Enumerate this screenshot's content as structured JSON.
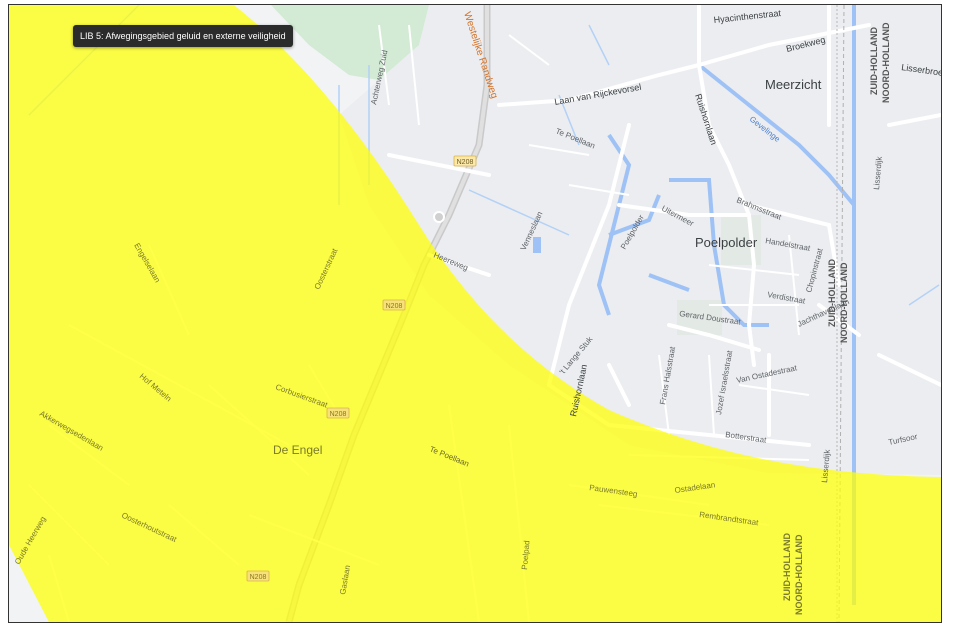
{
  "tooltip": {
    "text": "LIB 5: Afwegingsgebied geluid en externe veiligheid"
  },
  "overlay": {
    "color": "#ffff00",
    "opacity": 0.72
  },
  "places": {
    "meerzicht": "Meerzicht",
    "poelpolder": "Poelpolder",
    "de_engel": "De Engel"
  },
  "roads": {
    "westelijke_randweg": "Westelijke Randweg",
    "laan_van_rijckevorsel": "Laan van Rijckevorsel",
    "hyacinthenstraat": "Hyacinthenstraat",
    "broekweg": "Broekweg",
    "lisserbroek": "Lisserbroe",
    "ruishornlaan_north": "Ruishornlaan",
    "ruishornlaan_south": "Ruishornlaan",
    "gevelinge": "Gevelinge",
    "brahmsstraat": "Brahmsstraat",
    "handelstraat": "Handelstraat",
    "chopinstraat": "Chopinstraat",
    "verdistraat": "Verdistraat",
    "uitermeer": "Uitermeer",
    "poelpolder_road": "Poelpolder",
    "te_poellaan_top": "Te Poellaan",
    "te_poellaan_bottom": "Te Poellaan",
    "heereweg": "Heereweg",
    "venneslaan": "Venneslaan",
    "gerard_doustraat": "Gerard Doustraat",
    "jacob_cats": "'t Lange Stuk",
    "frans_halsstraat": "Frans Halsstraat",
    "jozef_israelsstraat": "Jozef Israelsstraat",
    "van_ostadestraat": "Van Ostadestraat",
    "botterstraat": "Botterstraat",
    "lisserdijk_top": "Lisserdijk",
    "lisserdijk_bottom": "Lisserdijk",
    "tortosoor": "Turfsoor",
    "achterweg_zuid": "Achterweg Zuid",
    "engelselaan": "Engelselaan",
    "oosterstraat": "Oosterstraat",
    "de_engel_street": "Corbusierstraat",
    "pauwenstraat": "Pauwensteeg",
    "ostadestraat2": "Ostadelaan",
    "zeestraat": "Jachthavenlaan",
    "akkerweg": "Akkerwegsedenlaan",
    "oude_heerweg": "Oude Heerweg",
    "poelpad": "Poelpad",
    "gaslaan": "Gaslaan",
    "oosterhoutstraat": "Oosterhoutstraat",
    "rembrandtstraat": "Rembrandtstraat",
    "hof_meteln": "Hof Meteln",
    "noord_holland_vert": "NOORD-HOLLAND",
    "zuid_holland_vert": "ZUID-HOLLAND"
  },
  "shields": {
    "n208_a": "N208",
    "n208_b": "N208",
    "n208_c": "N208",
    "n208_d": "N208"
  },
  "province_labels": {
    "top_zuid": "ZUID-HOLLAND",
    "top_noord": "NOORD-HOLLAND",
    "mid_zuid": "ZUID-HOLLAND",
    "mid_noord": "NOORD-HOLLAND",
    "bottom_zuid": "ZUID-HOLLAND",
    "bottom_noord": "NOORD-HOLLAND"
  }
}
